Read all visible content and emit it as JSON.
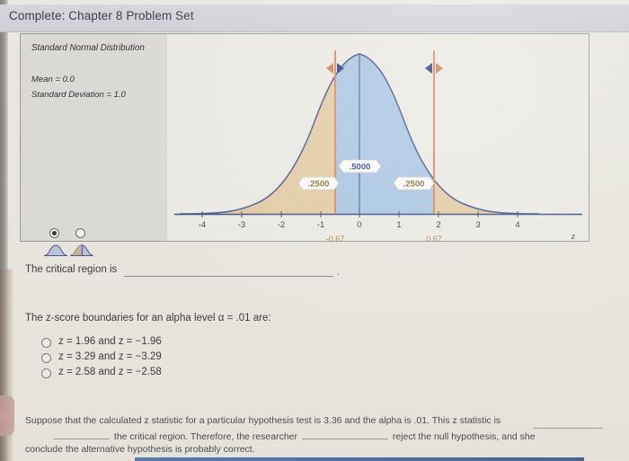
{
  "header": {
    "title": "Complete: Chapter 8 Problem Set"
  },
  "applet": {
    "distribution_title": "Standard Normal Distribution",
    "mean_label": "Mean = 0.0",
    "sd_label": "Standard Deviation = 1.0",
    "mode_options": [
      {
        "name": "two-tailed-plain",
        "selected": true
      },
      {
        "name": "two-tailed-split",
        "selected": false
      }
    ]
  },
  "chart_data": {
    "type": "area",
    "title": "Standard Normal Distribution",
    "xlabel": "z",
    "ylabel": "",
    "mean": 0.0,
    "sd": 1.0,
    "xlim": [
      -4.6,
      4.6
    ],
    "xticks": [
      "-4",
      "-3",
      "-2",
      "-1",
      "0",
      "1",
      "2",
      "3",
      "4"
    ],
    "xtick_values": [
      -4,
      -3,
      -2,
      -1,
      0,
      1,
      2,
      3,
      4
    ],
    "grid": false,
    "legend": null,
    "cursors": [
      {
        "value": -0.67,
        "label": "-0.67",
        "color": "#d98a5e"
      },
      {
        "value": 0.67,
        "label": "0.67",
        "color": "#d98a5e"
      }
    ],
    "regions": [
      {
        "name": "left-tail",
        "from": -4.6,
        "to": -0.67,
        "proportion": 0.25,
        "label": ".2500",
        "color": "#e3cba4"
      },
      {
        "name": "center",
        "from": -0.67,
        "to": 0.67,
        "proportion": 0.5,
        "label": ".5000",
        "color": "#a9c6e3"
      },
      {
        "name": "right-tail",
        "from": 0.67,
        "to": 4.6,
        "proportion": 0.25,
        "label": ".2500",
        "color": "#e3cba4"
      }
    ],
    "axis_color": "#4a5a8c",
    "curve_color": "#46568f"
  },
  "questions": {
    "q1": {
      "prompt": "The critical region is",
      "answer": "",
      "trailing": "."
    },
    "q2": {
      "prompt": "The z-score boundaries for an alpha level α = .01 are:",
      "options": [
        "z = 1.96 and z = −1.96",
        "z = 3.29 and z = −3.29",
        "z = 2.58 and z = −2.58"
      ],
      "selected": null
    }
  },
  "paragraph": {
    "line1_a": "Suppose that the calculated z statistic for a particular hypothesis test is 3.36 and the alpha is .01. This z statistic is",
    "line2_a": "the critical region. Therefore, the researcher",
    "line2_b": "reject the null hypothesis, and she",
    "line3_a": "conclude the alternative hypothesis is probably correct.",
    "blank1": "",
    "blank2": "",
    "blank3": ""
  }
}
